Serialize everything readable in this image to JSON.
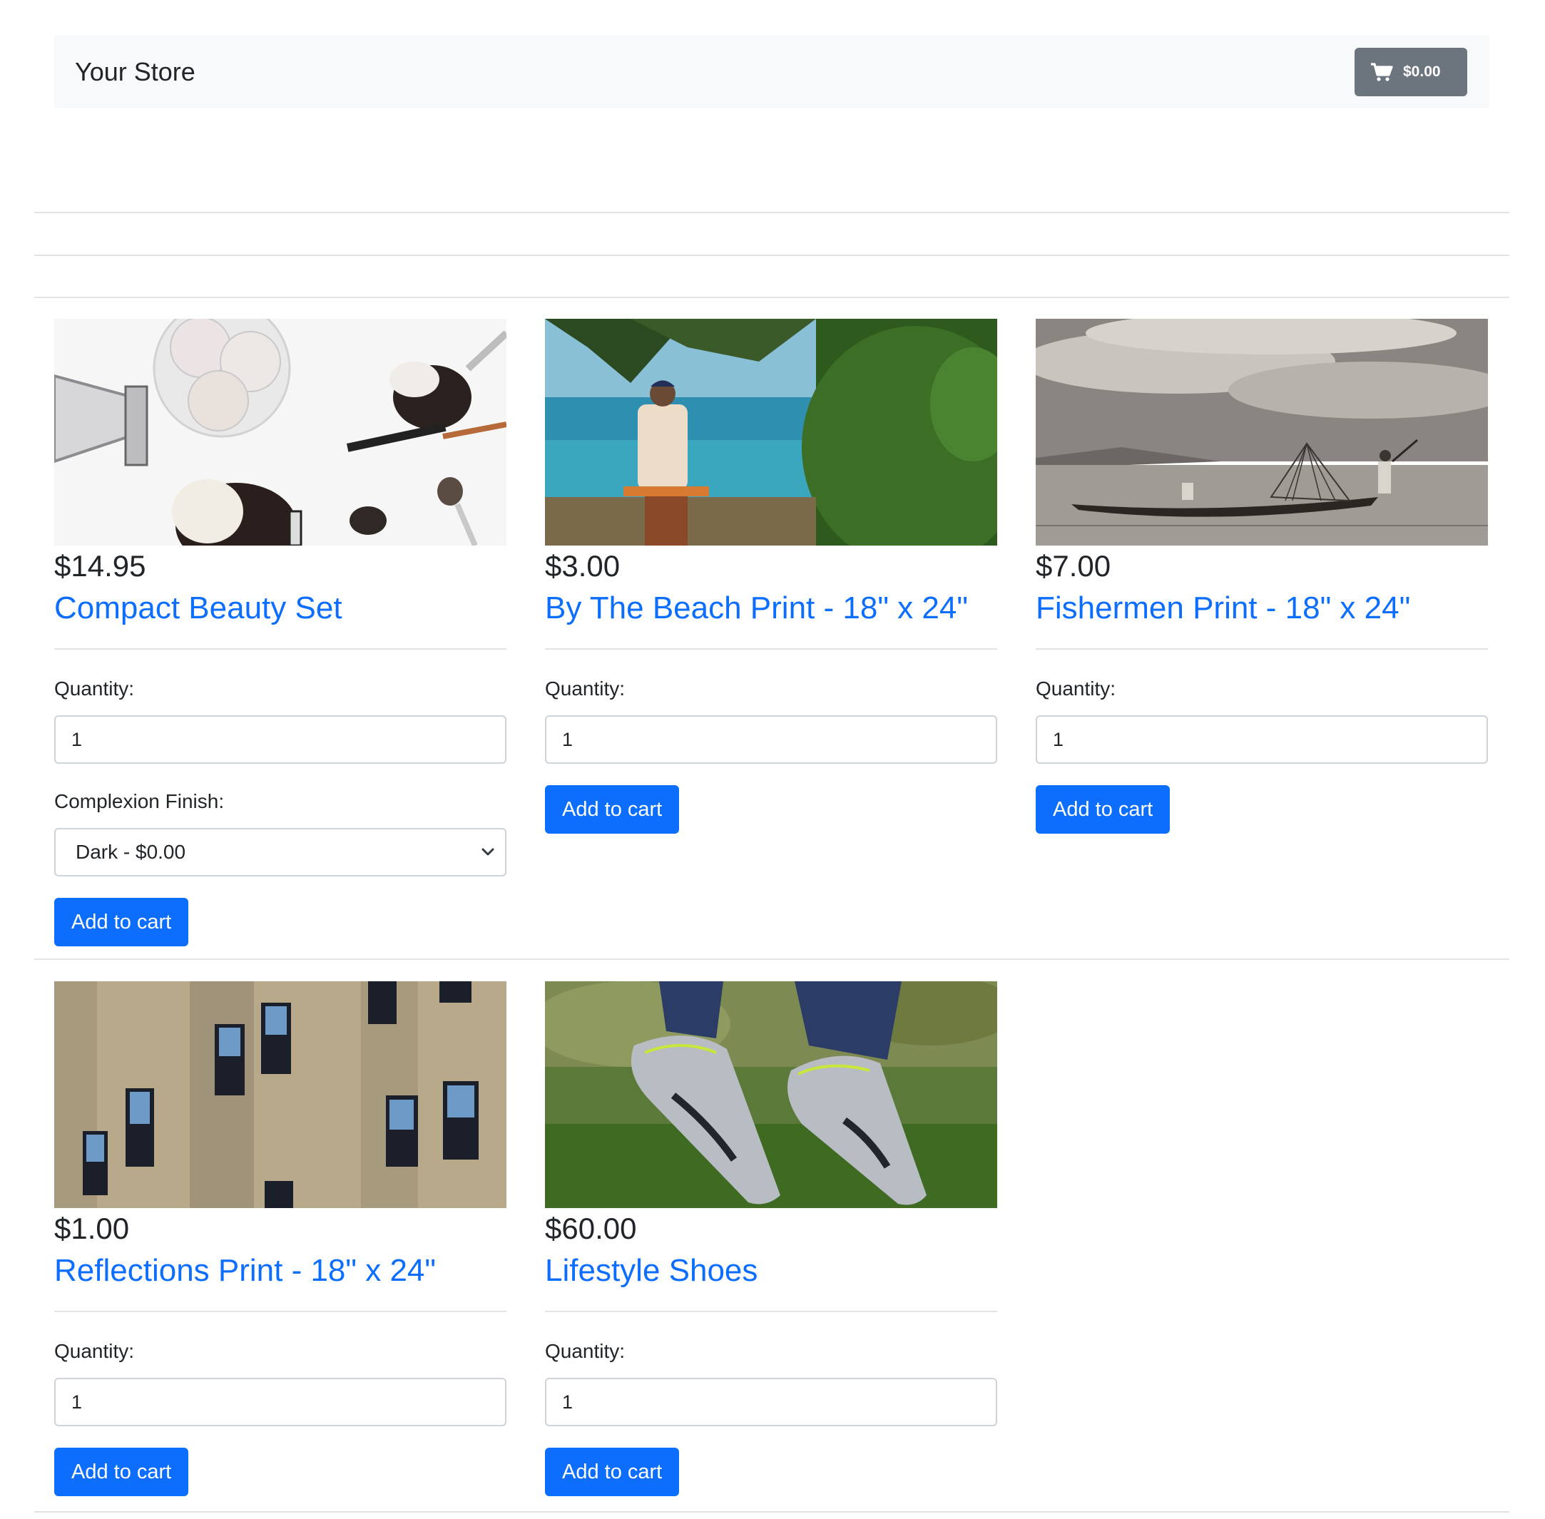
{
  "navbar": {
    "brand": "Your Store",
    "cart_total": "$0.00",
    "cart_icon": "shopping-cart-icon"
  },
  "colors": {
    "accent": "#0d6efd",
    "cart_button": "#6c757d",
    "navbar_bg": "#f8f9fa"
  },
  "products": [
    {
      "price": "$14.95",
      "title": "Compact Beauty Set",
      "quantity_label": "Quantity:",
      "quantity_value": "1",
      "option_label": "Complexion Finish:",
      "option_selected": "Dark - $0.00",
      "button": "Add to cart",
      "image": "makeup-brushes-image"
    },
    {
      "price": "$3.00",
      "title": "By The Beach Print - 18\" x 24\"",
      "quantity_label": "Quantity:",
      "quantity_value": "1",
      "button": "Add to cart",
      "image": "beach-palm-image"
    },
    {
      "price": "$7.00",
      "title": "Fishermen Print - 18\" x 24\"",
      "quantity_label": "Quantity:",
      "quantity_value": "1",
      "button": "Add to cart",
      "image": "fishermen-boat-image"
    },
    {
      "price": "$1.00",
      "title": "Reflections Print - 18\" x 24\"",
      "quantity_label": "Quantity:",
      "quantity_value": "1",
      "button": "Add to cart",
      "image": "brick-building-windows-image"
    },
    {
      "price": "$60.00",
      "title": "Lifestyle Shoes",
      "quantity_label": "Quantity:",
      "quantity_value": "1",
      "button": "Add to cart",
      "image": "sneakers-on-grass-image"
    }
  ]
}
